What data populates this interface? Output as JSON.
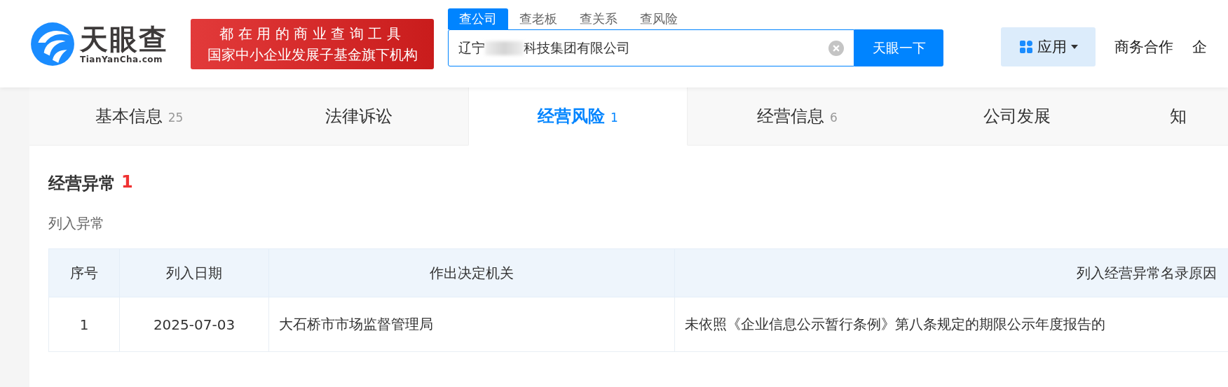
{
  "header": {
    "logo": {
      "name": "天眼查",
      "domain": "TianYanCha.com"
    },
    "slogan": {
      "line_1": "都在用的商业查询工具",
      "line_2": "国家中小企业发展子基金旗下机构"
    },
    "search": {
      "tabs": [
        {
          "label": "查公司",
          "selected": true
        },
        {
          "label": "查老板",
          "selected": false
        },
        {
          "label": "查关系",
          "selected": false
        },
        {
          "label": "查风险",
          "selected": false
        }
      ],
      "value_start": "辽宁",
      "value_blurred": true,
      "value_end": "科技集团有限公司",
      "button": "天眼一下"
    },
    "apps_button": "应用",
    "links": [
      "商务合作",
      "企"
    ]
  },
  "nav_tabs": [
    {
      "label": "基本信息",
      "count": "25",
      "selected": false
    },
    {
      "label": "法律诉讼",
      "selected": false
    },
    {
      "label": "经营风险",
      "count": "1",
      "selected": true
    },
    {
      "label": "经营信息",
      "count": "6",
      "selected": false
    },
    {
      "label": "公司发展",
      "selected": false
    },
    {
      "label": "知",
      "selected": false
    }
  ],
  "section": {
    "title": "经营异常",
    "count": "1",
    "subtitle": "列入异常",
    "table": {
      "columns": [
        "序号",
        "列入日期",
        "作出决定机关",
        "列入经营异常名录原因"
      ],
      "rows": [
        [
          "1",
          "2025-07-03",
          "大石桥市市场监督管理局",
          "未依照《企业信息公示暂行条例》第八条规定的期限公示年度报告的"
        ]
      ]
    }
  }
}
